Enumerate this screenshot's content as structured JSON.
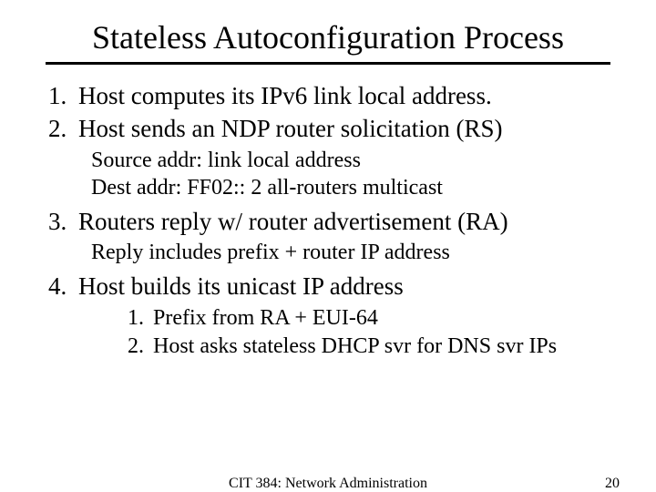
{
  "title": "Stateless Autoconfiguration Process",
  "steps": {
    "s1": "Host computes its IPv6 link local address.",
    "s2": "Host sends an NDP router solicitation (RS)",
    "s2_sub1": "Source addr: link local address",
    "s2_sub2": "Dest addr: FF02:: 2 all-routers multicast",
    "s3": "Routers reply w/ router advertisement (RA)",
    "s3_sub1": "Reply includes prefix + router IP address",
    "s4": "Host builds its unicast IP address",
    "s4_inner1": "Prefix from RA + EUI-64",
    "s4_inner2": "Host asks stateless DHCP svr for DNS svr IPs"
  },
  "footer": {
    "center": "CIT 384: Network Administration",
    "page": "20"
  }
}
